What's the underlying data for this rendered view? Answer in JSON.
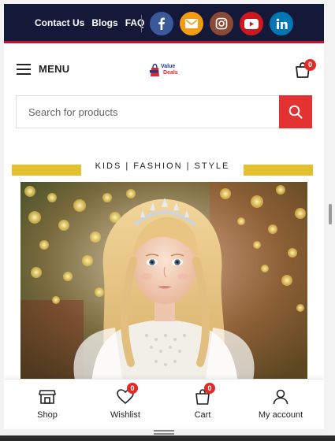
{
  "topbar": {
    "links": [
      "Contact Us",
      "Blogs",
      "FAQ"
    ],
    "social": [
      {
        "icon": "facebook-icon",
        "color": "#3b5998"
      },
      {
        "icon": "email-icon",
        "color": "#f39c12"
      },
      {
        "icon": "instagram-icon",
        "color": "#8a4a35"
      },
      {
        "icon": "youtube-icon",
        "color": "#cc181e"
      },
      {
        "icon": "linkedin-icon",
        "color": "#0077b5"
      }
    ],
    "accent": "#c8102e"
  },
  "header": {
    "menu_label": "MENU",
    "logo": {
      "line1": "Value",
      "line2": "Deals"
    },
    "cart_count": "0"
  },
  "search": {
    "placeholder": "Search for products",
    "button_color": "#e23332"
  },
  "tagline": "KIDS | FASHION | STYLE",
  "tag_color": "#e5c02e",
  "bottom_nav": [
    {
      "label": "Shop",
      "icon": "shop-icon"
    },
    {
      "label": "Wishlist",
      "icon": "heart-icon",
      "badge": "0"
    },
    {
      "label": "Cart",
      "icon": "cart-icon",
      "badge": "0"
    },
    {
      "label": "My account",
      "icon": "user-icon"
    }
  ]
}
